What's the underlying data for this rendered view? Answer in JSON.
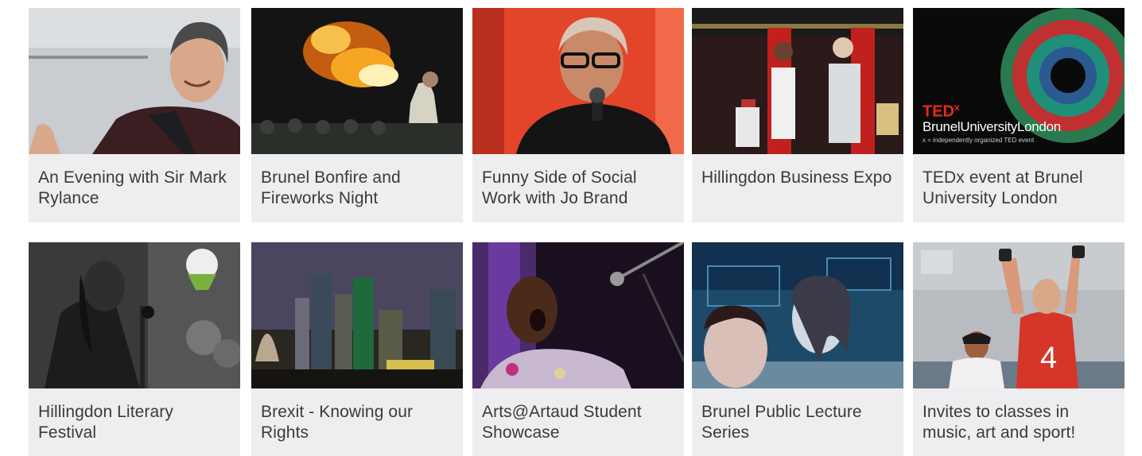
{
  "events": [
    {
      "title": "An Evening with Sir Mark Rylance"
    },
    {
      "title": "Brunel Bonfire and Fireworks Night"
    },
    {
      "title": "Funny Side of Social Work with Jo Brand"
    },
    {
      "title": "Hillingdon Business Expo"
    },
    {
      "title": "TEDx event at Brunel University London"
    },
    {
      "title": "Hillingdon Literary Festival"
    },
    {
      "title": "Brexit - Knowing our Rights"
    },
    {
      "title": "Arts@Artaud Student Showcase"
    },
    {
      "title": "Brunel Public Lecture Series"
    },
    {
      "title": "Invites to classes in music, art and sport!"
    }
  ],
  "tedx": {
    "logo": "TED",
    "logo_sup": "x",
    "brand": "BrunelUniversityLondon",
    "tagline": "x = independently organized TED event"
  },
  "sport": {
    "shirt_number": "4"
  },
  "colors": {
    "card_bg": "#eeeef0",
    "caption_text": "#3a3a3a",
    "ted_red": "#e62b1e"
  }
}
